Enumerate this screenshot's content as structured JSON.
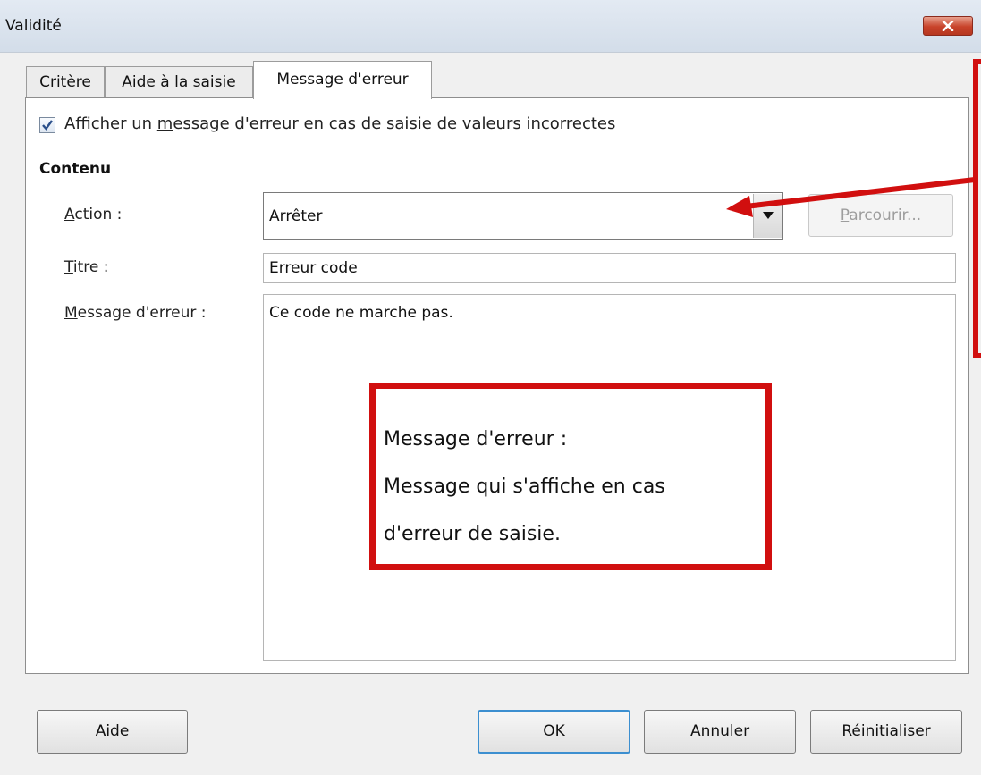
{
  "window": {
    "title": "Validité",
    "close_icon": "close-icon"
  },
  "tabs": [
    {
      "label": "Critère",
      "active": false
    },
    {
      "label": "Aide à la saisie",
      "active": false
    },
    {
      "label": "Message d'erreur",
      "active": true
    }
  ],
  "error_tab": {
    "show_checkbox": {
      "checked": true,
      "label_before": "Afficher un ",
      "label_mnemonic": "m",
      "label_after": "essage d'erreur en cas de saisie de valeurs incorrectes"
    },
    "section_title": "Contenu",
    "action": {
      "label_mnemonic": "A",
      "label_rest": "ction :",
      "value": "Arrêter"
    },
    "browse_button": {
      "label_mnemonic": "P",
      "label_rest": "arcourir..."
    },
    "title_field": {
      "label_mnemonic": "T",
      "label_rest": "itre :",
      "value": "Erreur code"
    },
    "message_field": {
      "label_mnemonic": "M",
      "label_rest": "essage d'erreur :",
      "value": "Ce code ne marche pas."
    }
  },
  "buttons": {
    "help": {
      "label_mnemonic": "A",
      "label_rest": "ide"
    },
    "ok": {
      "label": "OK"
    },
    "cancel": {
      "label": "Annuler"
    },
    "reset": {
      "label_mnemonic": "R",
      "label_rest": "éinitialiser"
    }
  },
  "annotation": {
    "lines": [
      "Message d'erreur :",
      "Message qui s'affiche en cas",
      "d'erreur de saisie."
    ],
    "color": "#d10f0f"
  },
  "colors": {
    "accent": "#3c8fd0",
    "annotation": "#d10f0f",
    "close": "#c8432b"
  }
}
